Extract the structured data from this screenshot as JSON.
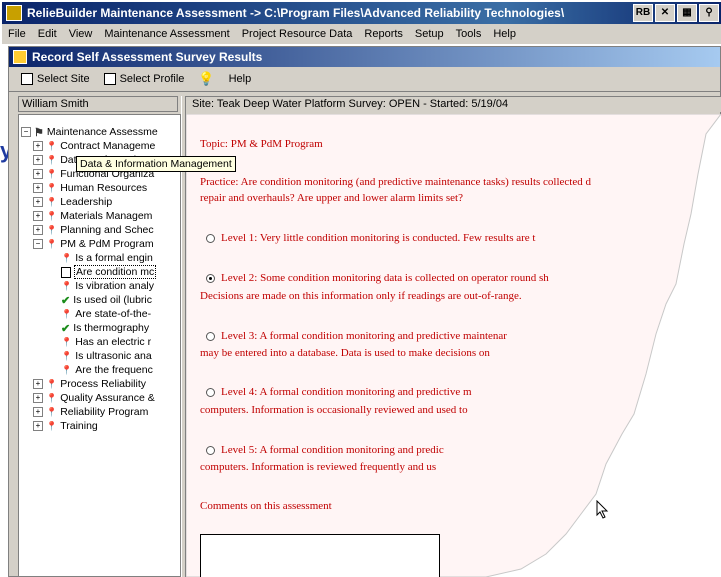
{
  "app": {
    "title": "RelieBuilder Maintenance Assessment -> C:\\Program Files\\Advanced Reliability Technologies\\",
    "menu": [
      "File",
      "Edit",
      "View",
      "Maintenance Assessment",
      "Project Resource Data",
      "Reports",
      "Setup",
      "Tools",
      "Help"
    ]
  },
  "child": {
    "title": "Record Self Assessment Survey Results",
    "toolbar": {
      "select_site": "Select Site",
      "select_profile": "Select Profile",
      "help": "Help"
    }
  },
  "user_name": "William Smith",
  "site_line": "Site: Teak Deep Water Platform    Survey: OPEN - Started: 5/19/04",
  "tooltip": "Data & Information Management",
  "left_edge_letter": "y",
  "tree": {
    "root": "Maintenance Assessme",
    "categories": [
      "Contract Manageme",
      "Data & Information Management",
      "Functional Organiza",
      "Human Resources",
      "Leadership",
      "Materials Managem",
      "Planning and Schec",
      "PM & PdM Program"
    ],
    "pm_children": [
      {
        "label": "Is a formal engin",
        "icon": "pin"
      },
      {
        "label": "Are condition mc",
        "icon": "doc",
        "selected": true
      },
      {
        "label": "Is vibration analy",
        "icon": "pin"
      },
      {
        "label": "Is used oil (lubric",
        "icon": "check"
      },
      {
        "label": "Are state-of-the-",
        "icon": "pin"
      },
      {
        "label": "Is thermography",
        "icon": "check"
      },
      {
        "label": "Has an electric r",
        "icon": "pin"
      },
      {
        "label": "Is ultrasonic ana",
        "icon": "pin"
      },
      {
        "label": "Are the frequenc",
        "icon": "pin"
      }
    ],
    "more_categories": [
      "Process Reliability",
      "Quality Assurance &",
      "Reliability Program",
      "Training"
    ]
  },
  "survey": {
    "topic": "Topic: PM & PdM Program",
    "practice_line1": "Practice: Are condition monitoring (and predictive maintenance tasks) results collected d",
    "practice_line2": "repair and overhauls? Are upper and lower alarm limits set?",
    "levels": [
      {
        "line1": "Level 1: Very little condition monitoring is conducted. Few results are t",
        "line2": "",
        "selected": false
      },
      {
        "line1": "Level 2: Some condition monitoring data is collected on operator round sh",
        "line2": "Decisions are made on this information only if readings are out-of-range.",
        "selected": true
      },
      {
        "line1": "Level 3: A formal condition monitoring and predictive maintenar",
        "line2": "may be entered into a database. Data is used to make decisions on",
        "selected": false
      },
      {
        "line1": "Level 4: A formal condition monitoring and predictive m",
        "line2": "computers. Information is occasionally reviewed and used to",
        "selected": false
      },
      {
        "line1": "Level 5: A formal condition monitoring and predic",
        "line2": "computers. Information is reviewed frequently and us",
        "selected": false
      }
    ],
    "comments_label": "Comments on this assessment"
  }
}
